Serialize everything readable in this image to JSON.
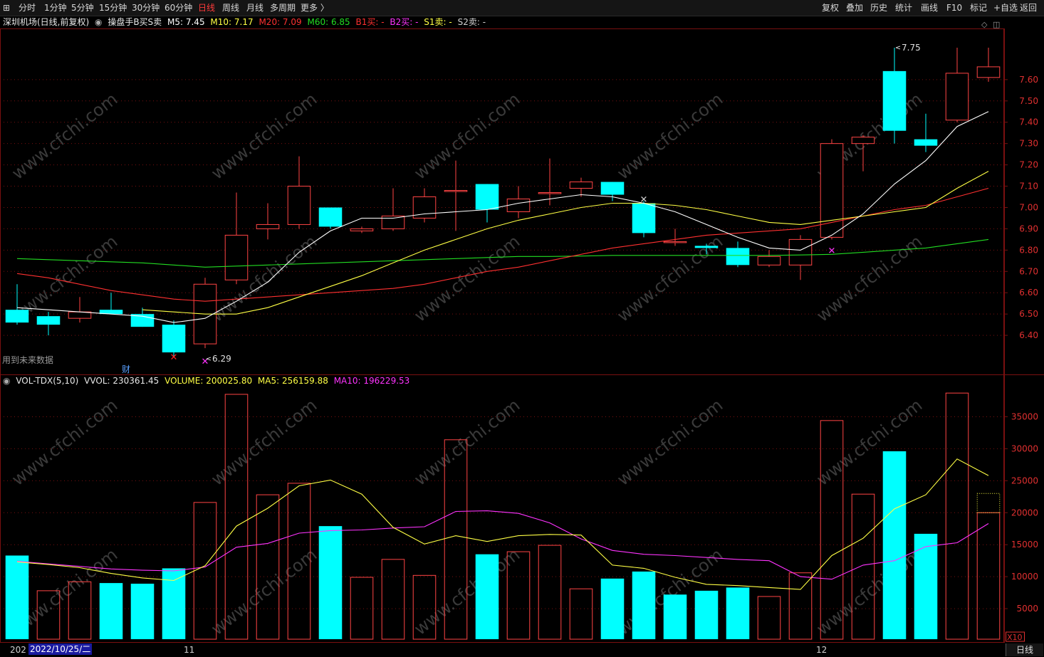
{
  "toolbar": {
    "left": [
      "分时",
      "1分钟",
      "5分钟",
      "15分钟",
      "30分钟",
      "60分钟",
      "日线",
      "周线",
      "月线",
      "多周期",
      "更多 〉"
    ],
    "active": "日线",
    "right": [
      "复权",
      "叠加",
      "历史",
      "统计",
      "画线",
      "F10",
      "标记",
      "+自选",
      "返回"
    ]
  },
  "stock": {
    "name": "深圳机场(日线,前复权)",
    "indicator": "操盘手B买S卖",
    "m5_label": "M5: 7.45",
    "m10_label": "M10: 7.17",
    "m20_label": "M20: 7.09",
    "m60_label": "M60: 6.85",
    "b1_label": "B1买: -",
    "b2_label": "B2买: -",
    "s1_label": "S1卖: -",
    "s2_label": "S2卖: -",
    "future_note": "用到未来数据",
    "fin_mark": "财"
  },
  "volume": {
    "label": "VOL-TDX(5,10)",
    "vvol": "VVOL: 230361.45",
    "volume": "VOLUME: 200025.80",
    "ma5": "MA5: 256159.88",
    "ma10": "MA10: 196229.53",
    "multiplier": "X10"
  },
  "dates": {
    "first": "202",
    "current": "2022/10/25/二",
    "m11": "11",
    "m12": "12",
    "period": "日线"
  },
  "watermark": "www.cfchi.com",
  "colors": {
    "up": "#ff4444",
    "down": "#00ffff",
    "ma5": "#ffffff",
    "ma10": "#ffff44",
    "ma20": "#ff3030",
    "ma60": "#22dd22",
    "vol_ma5": "#ffff44",
    "vol_ma10": "#ff33ff",
    "grid": "#7a1010",
    "axis_text": "#e03030"
  },
  "chart_data": [
    {
      "type": "candlestick",
      "y_ticks": [
        6.4,
        6.5,
        6.6,
        6.7,
        6.8,
        6.9,
        7.0,
        7.1,
        7.2,
        7.3,
        7.4,
        7.5,
        7.6
      ],
      "ylim": [
        6.22,
        7.84
      ],
      "annotations": [
        {
          "label": "6.29",
          "index": 6,
          "value": 6.29
        },
        {
          "label": "7.75",
          "index": 28,
          "value": 7.75
        }
      ],
      "candles": [
        {
          "o": 6.52,
          "h": 6.64,
          "l": 6.45,
          "c": 6.46
        },
        {
          "o": 6.49,
          "h": 6.51,
          "l": 6.4,
          "c": 6.45
        },
        {
          "o": 6.48,
          "h": 6.58,
          "l": 6.46,
          "c": 6.51
        },
        {
          "o": 6.52,
          "h": 6.6,
          "l": 6.51,
          "c": 6.5
        },
        {
          "o": 6.5,
          "h": 6.53,
          "l": 6.44,
          "c": 6.44
        },
        {
          "o": 6.45,
          "h": 6.47,
          "l": 6.3,
          "c": 6.32
        },
        {
          "o": 6.36,
          "h": 6.67,
          "l": 6.34,
          "c": 6.64
        },
        {
          "o": 6.66,
          "h": 7.07,
          "l": 6.64,
          "c": 6.87
        },
        {
          "o": 6.9,
          "h": 7.02,
          "l": 6.85,
          "c": 6.92
        },
        {
          "o": 6.92,
          "h": 7.24,
          "l": 6.9,
          "c": 7.1
        },
        {
          "o": 7.0,
          "h": 7.0,
          "l": 6.9,
          "c": 6.91
        },
        {
          "o": 6.89,
          "h": 6.91,
          "l": 6.88,
          "c": 6.9
        },
        {
          "o": 6.9,
          "h": 7.09,
          "l": 6.89,
          "c": 6.96
        },
        {
          "o": 6.95,
          "h": 7.09,
          "l": 6.93,
          "c": 7.05
        },
        {
          "o": 7.08,
          "h": 7.22,
          "l": 6.89,
          "c": 7.08
        },
        {
          "o": 7.11,
          "h": 7.11,
          "l": 6.93,
          "c": 6.99
        },
        {
          "o": 6.98,
          "h": 7.1,
          "l": 6.95,
          "c": 7.04
        },
        {
          "o": 7.07,
          "h": 7.23,
          "l": 7.01,
          "c": 7.07
        },
        {
          "o": 7.09,
          "h": 7.14,
          "l": 7.05,
          "c": 7.12
        },
        {
          "o": 7.12,
          "h": 7.12,
          "l": 7.03,
          "c": 7.06
        },
        {
          "o": 7.02,
          "h": 7.03,
          "l": 6.86,
          "c": 6.88
        },
        {
          "o": 6.84,
          "h": 6.9,
          "l": 6.82,
          "c": 6.84
        },
        {
          "o": 6.82,
          "h": 6.83,
          "l": 6.78,
          "c": 6.81
        },
        {
          "o": 6.81,
          "h": 6.84,
          "l": 6.72,
          "c": 6.73
        },
        {
          "o": 6.73,
          "h": 6.8,
          "l": 6.72,
          "c": 6.77
        },
        {
          "o": 6.73,
          "h": 6.87,
          "l": 6.66,
          "c": 6.85
        },
        {
          "o": 6.86,
          "h": 7.32,
          "l": 6.85,
          "c": 7.3
        },
        {
          "o": 7.3,
          "h": 7.34,
          "l": 7.17,
          "c": 7.33
        },
        {
          "o": 7.64,
          "h": 7.75,
          "l": 7.3,
          "c": 7.36
        },
        {
          "o": 7.32,
          "h": 7.44,
          "l": 7.26,
          "c": 7.29
        },
        {
          "o": 7.41,
          "h": 7.75,
          "l": 7.4,
          "c": 7.63
        },
        {
          "o": 7.61,
          "h": 7.75,
          "l": 7.59,
          "c": 7.66
        }
      ],
      "ma5": [
        6.53,
        6.52,
        6.51,
        6.5,
        6.49,
        6.46,
        6.48,
        6.56,
        6.65,
        6.79,
        6.89,
        6.95,
        6.95,
        6.97,
        6.98,
        6.99,
        7.02,
        7.04,
        7.06,
        7.05,
        7.02,
        6.98,
        6.92,
        6.86,
        6.81,
        6.8,
        6.87,
        6.97,
        7.11,
        7.22,
        7.38,
        7.45
      ],
      "ma10": [
        null,
        null,
        null,
        null,
        6.52,
        6.51,
        6.5,
        6.5,
        6.53,
        6.58,
        6.63,
        6.68,
        6.74,
        6.8,
        6.85,
        6.9,
        6.94,
        6.97,
        7.0,
        7.02,
        7.02,
        7.01,
        6.99,
        6.96,
        6.93,
        6.92,
        6.94,
        6.96,
        6.98,
        7.0,
        7.09,
        7.17
      ],
      "ma20": [
        6.69,
        6.67,
        6.64,
        6.61,
        6.59,
        6.57,
        6.56,
        6.57,
        6.58,
        6.59,
        6.6,
        6.61,
        6.62,
        6.64,
        6.67,
        6.7,
        6.72,
        6.75,
        6.78,
        6.81,
        6.83,
        6.85,
        6.87,
        6.88,
        6.89,
        6.9,
        6.93,
        6.96,
        6.99,
        7.01,
        7.05,
        7.09
      ],
      "ma60": [
        6.76,
        6.755,
        6.75,
        6.745,
        6.74,
        6.73,
        6.72,
        6.725,
        6.73,
        6.735,
        6.74,
        6.745,
        6.75,
        6.755,
        6.76,
        6.765,
        6.77,
        6.77,
        6.772,
        6.775,
        6.775,
        6.775,
        6.775,
        6.775,
        6.775,
        6.777,
        6.78,
        6.79,
        6.8,
        6.81,
        6.83,
        6.85
      ],
      "signals": [
        {
          "index": 5,
          "value": 6.3,
          "color": "#ff2020"
        },
        {
          "index": 6,
          "value": 6.28,
          "color": "#ff33ff"
        },
        {
          "index": 20,
          "value": 7.04,
          "color": "#d0d0d0"
        },
        {
          "index": 26,
          "value": 6.8,
          "color": "#ff33ff"
        }
      ]
    },
    {
      "type": "bar",
      "y_ticks": [
        5000,
        10000,
        15000,
        20000,
        25000,
        30000,
        35000
      ],
      "ylim": [
        0,
        39500
      ],
      "volumes": [
        13300,
        7800,
        9200,
        9000,
        8900,
        11300,
        21600,
        38500,
        22800,
        24600,
        17900,
        9900,
        12700,
        10200,
        31400,
        13500,
        13900,
        14900,
        8100,
        9700,
        10800,
        7200,
        7800,
        8300,
        6900,
        10600,
        34400,
        22900,
        29600,
        16700,
        38700,
        20000
      ],
      "up": [
        false,
        true,
        true,
        false,
        false,
        false,
        true,
        true,
        true,
        true,
        false,
        true,
        true,
        true,
        true,
        false,
        true,
        true,
        true,
        false,
        false,
        false,
        false,
        false,
        true,
        true,
        true,
        true,
        false,
        false,
        true,
        true
      ],
      "ma5": [
        12300,
        11900,
        11400,
        10500,
        9800,
        9400,
        11700,
        17900,
        20700,
        24200,
        25100,
        22900,
        17700,
        15100,
        16400,
        15500,
        16400,
        16600,
        16500,
        11800,
        11300,
        9900,
        8800,
        8600,
        8300,
        8000,
        13300,
        16000,
        20600,
        22800,
        28400,
        25800
      ],
      "ma10": [
        12400,
        12000,
        11600,
        11200,
        11000,
        10900,
        11500,
        14600,
        15200,
        16800,
        17200,
        17300,
        17600,
        17800,
        20200,
        20300,
        19900,
        18400,
        15900,
        14100,
        13500,
        13300,
        13000,
        12700,
        12500,
        10000,
        9600,
        11800,
        12500,
        14700,
        15300,
        18300,
        19600
      ]
    }
  ]
}
